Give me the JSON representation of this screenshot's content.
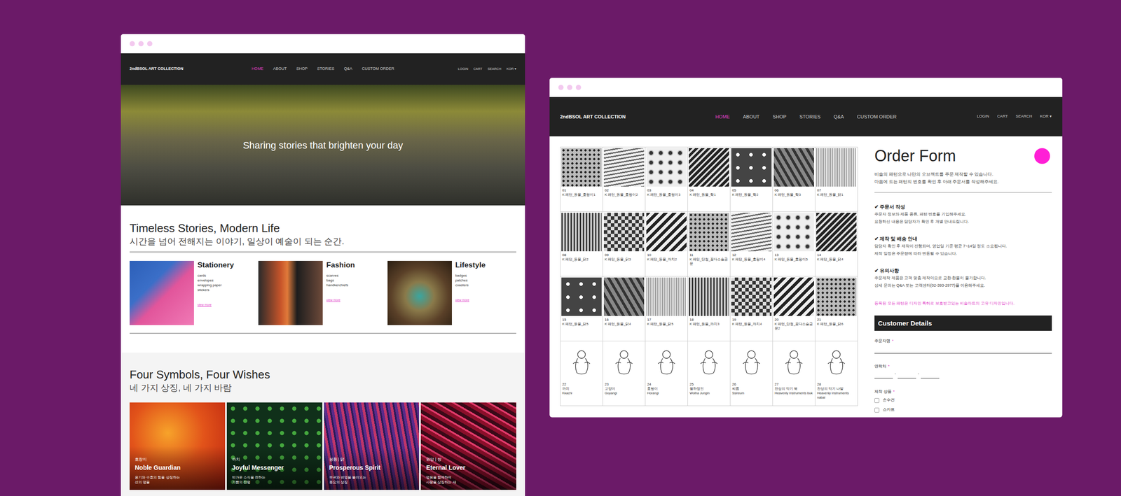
{
  "left_window": {
    "nav": {
      "logo": "2ndBSOL ART COLLECTION",
      "menu": [
        {
          "label": "HOME",
          "selected": true
        },
        {
          "label": "ABOUT",
          "selected": false
        },
        {
          "label": "SHOP",
          "selected": false
        },
        {
          "label": "STORIES",
          "selected": false
        },
        {
          "label": "Q&A",
          "selected": false
        },
        {
          "label": "CUSTOM ORDER",
          "selected": false
        }
      ],
      "utility": [
        "LOGIN",
        "CART",
        "SEARCH"
      ],
      "language": "KOR ▾"
    },
    "hero": {
      "tagline": "Sharing stories that brighten your day"
    },
    "intro": {
      "title": "Timeless Stories, Modern Life",
      "subtitle": "시간을 넘어 전해지는 이야기, 일상이 예술이 되는 순간."
    },
    "categories": [
      {
        "title": "Stationery",
        "items": [
          "cards",
          "envelopes",
          "wrapping paper",
          "stickers"
        ],
        "link": "view more"
      },
      {
        "title": "Fashion",
        "items": [
          "scarves",
          "bags",
          "handkerchiefs"
        ],
        "link": "view more"
      },
      {
        "title": "Lifestyle",
        "items": [
          "badges",
          "patches",
          "coasters"
        ],
        "link": "view more"
      }
    ],
    "symbols": {
      "title": "Four Symbols, Four Wishes",
      "subtitle": "네 가지 상징, 네 가지 바람",
      "cards": [
        {
          "tag": "호랑이",
          "title": "Noble Guardian",
          "lines": [
            "용기와 수호의 힘을 상징하는",
            "선의 명물"
          ]
        },
        {
          "tag": "까치",
          "title": "Joyful Messenger",
          "lines": [
            "반가운 소식을 전하는",
            "기쁨의 전령"
          ]
        },
        {
          "tag": "봉황 | 닭",
          "title": "Prosperous Spirit",
          "lines": [
            "부귀와 번영을 불러오는",
            "풍요의 상징"
          ]
        },
        {
          "tag": "원앙 | 쌍",
          "title": "Eternal Lover",
          "lines": [
            "영원을 함께하며",
            "사랑을 상징하는 새"
          ]
        }
      ]
    }
  },
  "right_window": {
    "nav": {
      "logo": "2ndBSOL ART COLLECTION",
      "menu": [
        {
          "label": "HOME",
          "selected": true
        },
        {
          "label": "ABOUT",
          "selected": false
        },
        {
          "label": "SHOP",
          "selected": false
        },
        {
          "label": "STORIES",
          "selected": false
        },
        {
          "label": "Q&A",
          "selected": false
        },
        {
          "label": "CUSTOM ORDER",
          "selected": false
        }
      ],
      "utility": [
        "LOGIN",
        "CART",
        "SEARCH"
      ],
      "language": "KOR ▾"
    },
    "patterns": [
      {
        "number": "01",
        "lines": [
          "K 패턴_동물_호랑이1"
        ],
        "kind": "pattern"
      },
      {
        "number": "02",
        "lines": [
          "K 패턴_동물_호랑이2"
        ],
        "kind": "pattern"
      },
      {
        "number": "03",
        "lines": [
          "K 패턴_동물_호랑이3"
        ],
        "kind": "pattern"
      },
      {
        "number": "04",
        "lines": [
          "K 패턴_동물_학1"
        ],
        "kind": "pattern"
      },
      {
        "number": "05",
        "lines": [
          "K 패턴_동물_학2"
        ],
        "kind": "pattern"
      },
      {
        "number": "06",
        "lines": [
          "K 패턴_동물_학3"
        ],
        "kind": "pattern"
      },
      {
        "number": "07",
        "lines": [
          "K 패턴_동물_닭1"
        ],
        "kind": "pattern"
      },
      {
        "number": "08",
        "lines": [
          "K 패턴_동물_닭2"
        ],
        "kind": "pattern"
      },
      {
        "number": "09",
        "lines": [
          "K 패턴_동물_닭3"
        ],
        "kind": "pattern"
      },
      {
        "number": "10",
        "lines": [
          "K 패턴_동물_까치2"
        ],
        "kind": "pattern"
      },
      {
        "number": "11",
        "lines": [
          "K 패턴_단청_꽃다소술금문"
        ],
        "kind": "pattern"
      },
      {
        "number": "12",
        "lines": [
          "K 패턴_동물_호랑이4"
        ],
        "kind": "pattern"
      },
      {
        "number": "13",
        "lines": [
          "K 패턴_동물_호랑이5"
        ],
        "kind": "pattern"
      },
      {
        "number": "14",
        "lines": [
          "K 패턴_동물_닭4"
        ],
        "kind": "pattern"
      },
      {
        "number": "15",
        "lines": [
          "K 패턴_동물_닭5"
        ],
        "kind": "pattern"
      },
      {
        "number": "16",
        "lines": [
          "K 패턴_동물_닭4"
        ],
        "kind": "pattern"
      },
      {
        "number": "17",
        "lines": [
          "K 패턴_동물_닭5"
        ],
        "kind": "pattern"
      },
      {
        "number": "18",
        "lines": [
          "K 패턴_동물_까치3"
        ],
        "kind": "pattern"
      },
      {
        "number": "19",
        "lines": [
          "K 패턴_동물_까치4"
        ],
        "kind": "pattern"
      },
      {
        "number": "20",
        "lines": [
          "K 패턴_단청_꽃다소술금문2"
        ],
        "kind": "pattern"
      },
      {
        "number": "21",
        "lines": [
          "K 패턴_동물_닭6"
        ],
        "kind": "pattern"
      },
      {
        "number": "22",
        "lines": [
          "까치",
          "Kkachi"
        ],
        "kind": "illustration"
      },
      {
        "number": "23",
        "lines": [
          "고양이",
          "Goyangi"
        ],
        "kind": "illustration"
      },
      {
        "number": "24",
        "lines": [
          "호랑이",
          "Horangi"
        ],
        "kind": "illustration"
      },
      {
        "number": "25",
        "lines": [
          "월하정인",
          "Wolha Jungin"
        ],
        "kind": "illustration"
      },
      {
        "number": "26",
        "lines": [
          "씨름",
          "Ssireum"
        ],
        "kind": "illustration"
      },
      {
        "number": "27",
        "lines": [
          "천상의 악기 북",
          "Heavenly Instruments buk"
        ],
        "kind": "illustration"
      },
      {
        "number": "28",
        "lines": [
          "천상의 악기 나발",
          "Heavenly Instruments",
          "nabal"
        ],
        "kind": "illustration"
      }
    ],
    "order_form": {
      "title": "Order Form",
      "intro": [
        "비솔의 패턴으로 나만의 오브젝트를 주문 제작할 수 있습니다.",
        "마음에 드는 패턴의 번호를 확인 후 아래 주문서를 작성해주세요."
      ],
      "sections": [
        {
          "title": "✔ 주문서 작성",
          "lines": [
            "주문자 정보와 제품 종류, 패턴 번호를 기입해주세요.",
            "요청하신 내용은 담당자가 확인 후 개별 안내드립니다."
          ]
        },
        {
          "title": "✔ 제작 및 배송 안내",
          "lines": [
            "담당자 확인 후 제작이 진행되며, 영업일 기준 평균 7~14일 정도 소요됩니다.",
            "제작 일정은 주문량에 따라 변동될 수 있습니다."
          ]
        },
        {
          "title": "✔ 유의사항",
          "lines": [
            "주문제작 제품은 고객 맞춤 제작이므로 교환·환불이 불가합니다.",
            "상세 문의는 Q&A 또는 고객센터(02-393-2977)를 이용해주세요."
          ]
        }
      ],
      "notice": "등록된 모든 패턴은 디자인 특허로 보호받고있는 비솔아트의 고유 디자인입니다.",
      "customer_details": {
        "title": "Customer Details",
        "fields": [
          {
            "label": "주문자명",
            "mark": "*",
            "kind": "text"
          },
          {
            "label": "연락처",
            "mark": "*",
            "kind": "phone",
            "separators": [
              "-",
              "-"
            ]
          },
          {
            "label": "제작 상품",
            "mark": "*",
            "kind": "checkboxes",
            "options": [
              {
                "label": "손수건",
                "checked": false
              },
              {
                "label": "스카프",
                "checked": false
              }
            ]
          }
        ]
      }
    }
  }
}
